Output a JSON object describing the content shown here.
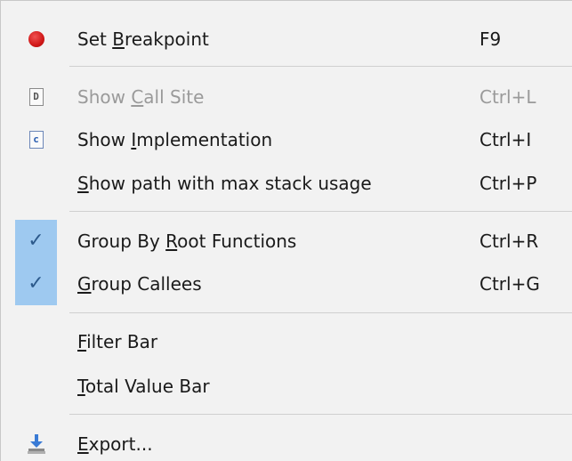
{
  "menu": {
    "items": [
      {
        "label_pre": "Set ",
        "label_key": "B",
        "label_post": "reakpoint",
        "shortcut": "F9",
        "icon": "breakpoint-dot-icon",
        "disabled": false,
        "checked": false
      },
      {
        "label_pre": "Show ",
        "label_key": "C",
        "label_post": "all Site",
        "shortcut": "Ctrl+L",
        "icon": "file-d-icon",
        "disabled": true,
        "checked": false
      },
      {
        "label_pre": "Show ",
        "label_key": "I",
        "label_post": "mplementation",
        "shortcut": "Ctrl+I",
        "icon": "file-c-icon",
        "disabled": false,
        "checked": false
      },
      {
        "label_pre": "",
        "label_key": "S",
        "label_post": "how path with max stack usage",
        "shortcut": "Ctrl+P",
        "icon": "",
        "disabled": false,
        "checked": false
      },
      {
        "label_pre": "Group By ",
        "label_key": "R",
        "label_post": "oot Functions",
        "shortcut": "Ctrl+R",
        "icon": "checkmark-icon",
        "disabled": false,
        "checked": true
      },
      {
        "label_pre": "",
        "label_key": "G",
        "label_post": "roup Callees",
        "shortcut": "Ctrl+G",
        "icon": "checkmark-icon",
        "disabled": false,
        "checked": true
      },
      {
        "label_pre": "",
        "label_key": "F",
        "label_post": "ilter Bar",
        "shortcut": "",
        "icon": "",
        "disabled": false,
        "checked": false
      },
      {
        "label_pre": "",
        "label_key": "T",
        "label_post": "otal Value Bar",
        "shortcut": "",
        "icon": "",
        "disabled": false,
        "checked": false
      },
      {
        "label_pre": "",
        "label_key": "E",
        "label_post": "xport...",
        "shortcut": "",
        "icon": "export-icon",
        "disabled": false,
        "checked": false
      }
    ],
    "icon_glyphs": {
      "file_d": "D",
      "file_c": "c",
      "check": "✓"
    },
    "colors": {
      "background": "#f2f2f2",
      "checked_highlight": "#9ec9f0",
      "disabled_text": "#9a9a9a",
      "breakpoint_red": "#d01818"
    }
  }
}
